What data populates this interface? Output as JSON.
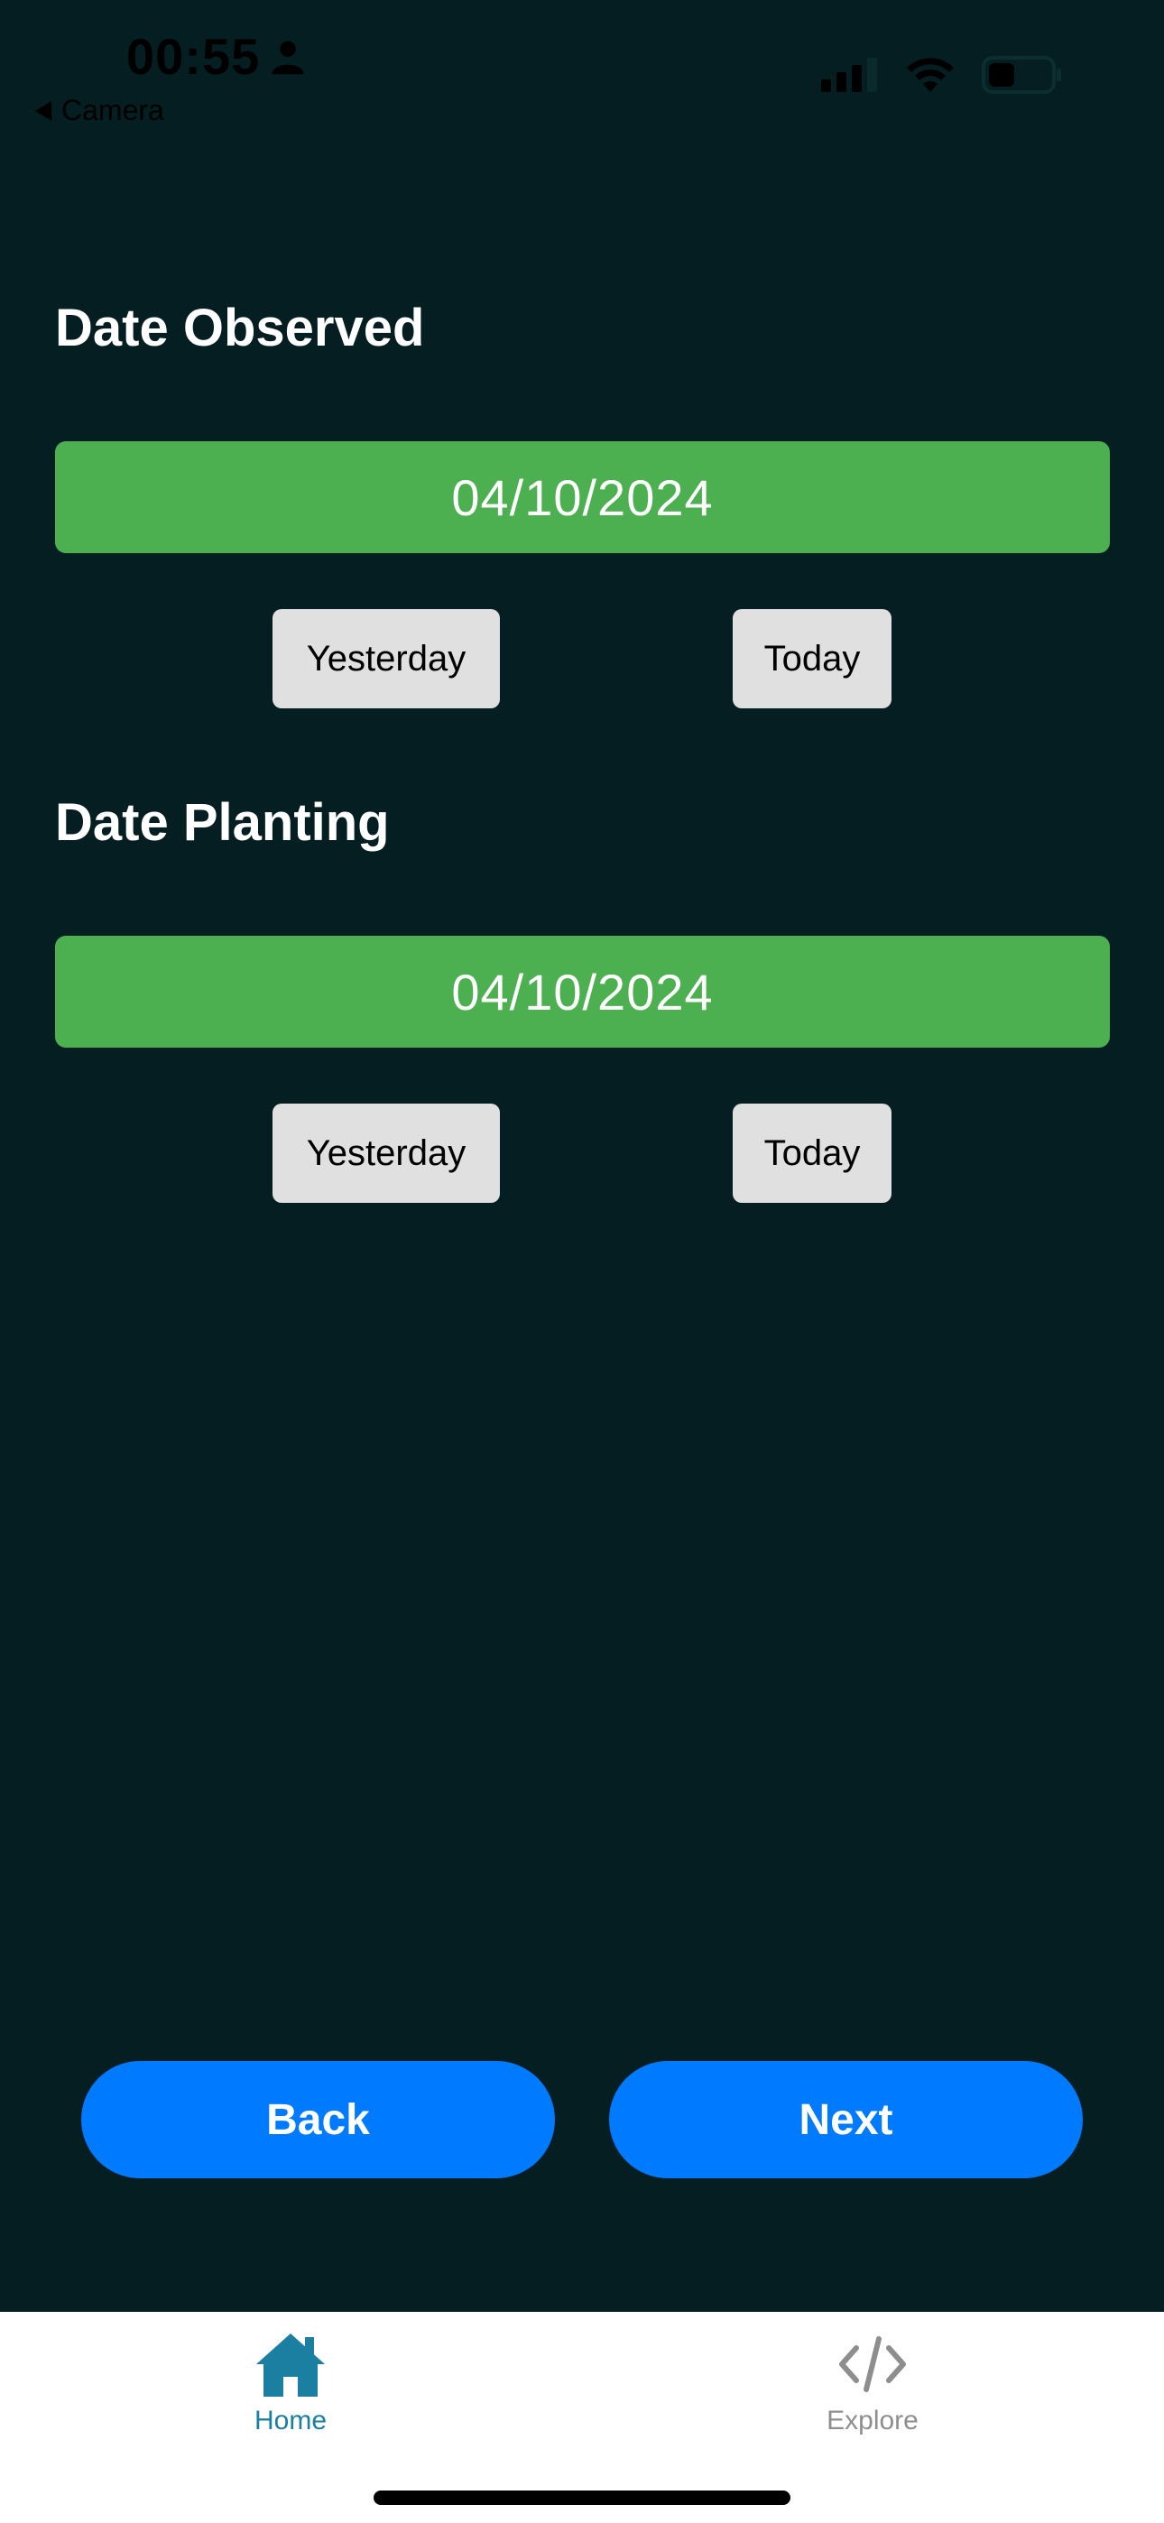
{
  "status_bar": {
    "time": "00:55",
    "back_app": "Camera"
  },
  "date_observed": {
    "title": "Date Observed",
    "value": "04/10/2024",
    "yesterday_label": "Yesterday",
    "today_label": "Today"
  },
  "date_planting": {
    "title": "Date Planting",
    "value": "04/10/2024",
    "yesterday_label": "Yesterday",
    "today_label": "Today"
  },
  "footer": {
    "back_label": "Back",
    "next_label": "Next"
  },
  "tab_bar": {
    "tabs": [
      {
        "label": "Home",
        "icon": "home-icon",
        "active": true
      },
      {
        "label": "Explore",
        "icon": "code-icon",
        "active": false
      }
    ]
  },
  "colors": {
    "background": "#041e21",
    "date_bar": "#4caf50",
    "primary_button": "#007aff",
    "quick_button": "#e0e0e0",
    "tab_active": "#1a7fa0",
    "tab_inactive": "#8e8e8e"
  }
}
